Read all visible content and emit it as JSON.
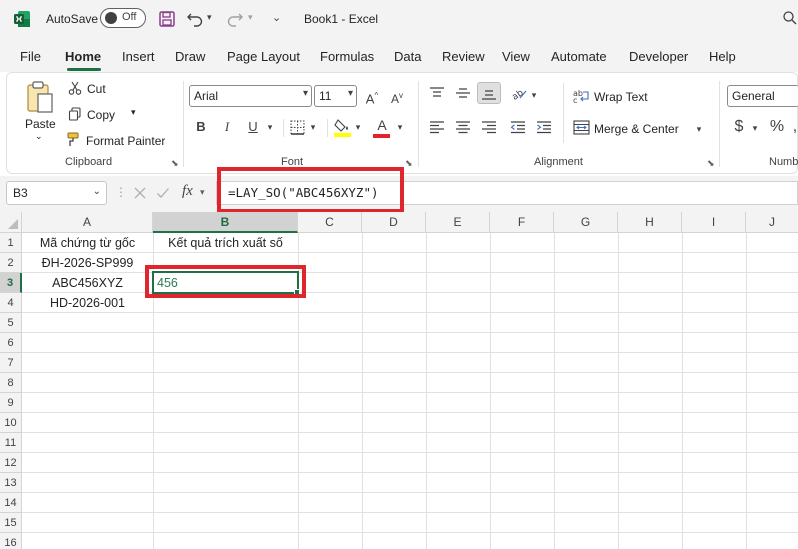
{
  "titlebar": {
    "autosave_label": "AutoSave",
    "autosave_state": "Off",
    "document_title": "Book1  -  Excel"
  },
  "menu": {
    "tabs": [
      "File",
      "Home",
      "Insert",
      "Draw",
      "Page Layout",
      "Formulas",
      "Data",
      "Review",
      "View",
      "Automate",
      "Developer",
      "Help"
    ],
    "active": "Home"
  },
  "ribbon": {
    "clipboard": {
      "paste": "Paste",
      "cut": "Cut",
      "copy": "Copy",
      "format_painter": "Format Painter",
      "group_label": "Clipboard"
    },
    "font": {
      "font_name": "Arial",
      "font_size": "11",
      "bold": "B",
      "italic": "I",
      "underline": "U",
      "group_label": "Font",
      "highlight_color": "#ffff00",
      "font_color": "#e0262d"
    },
    "alignment": {
      "wrap_text": "Wrap Text",
      "merge_center": "Merge & Center",
      "group_label": "Alignment"
    },
    "number": {
      "format": "General",
      "currency": "$",
      "percent": "%",
      "group_label": "Numb"
    }
  },
  "formula_bar": {
    "name_box": "B3",
    "fx": "fx",
    "formula": "=LAY_SO(\"ABC456XYZ\")"
  },
  "sheet": {
    "columns": [
      "A",
      "B",
      "C",
      "D",
      "E",
      "F",
      "G",
      "H",
      "I",
      "J"
    ],
    "rows": [
      "1",
      "2",
      "3",
      "4",
      "5",
      "6",
      "7",
      "8",
      "9",
      "10",
      "11",
      "12",
      "13",
      "14",
      "15",
      "16"
    ],
    "selected_column": "B",
    "selected_row": "3",
    "cells": {
      "A1": "Mã chứng từ gốc",
      "B1": "Kết quả trích xuất số",
      "A2": "ĐH-2026-SP999",
      "A3": "ABC456XYZ",
      "B3": "456",
      "A4": "HD-2026-001"
    }
  },
  "colors": {
    "excel_green": "#1e7145",
    "highlight_red": "#e0262d",
    "result_text": "#2e7d4f"
  }
}
